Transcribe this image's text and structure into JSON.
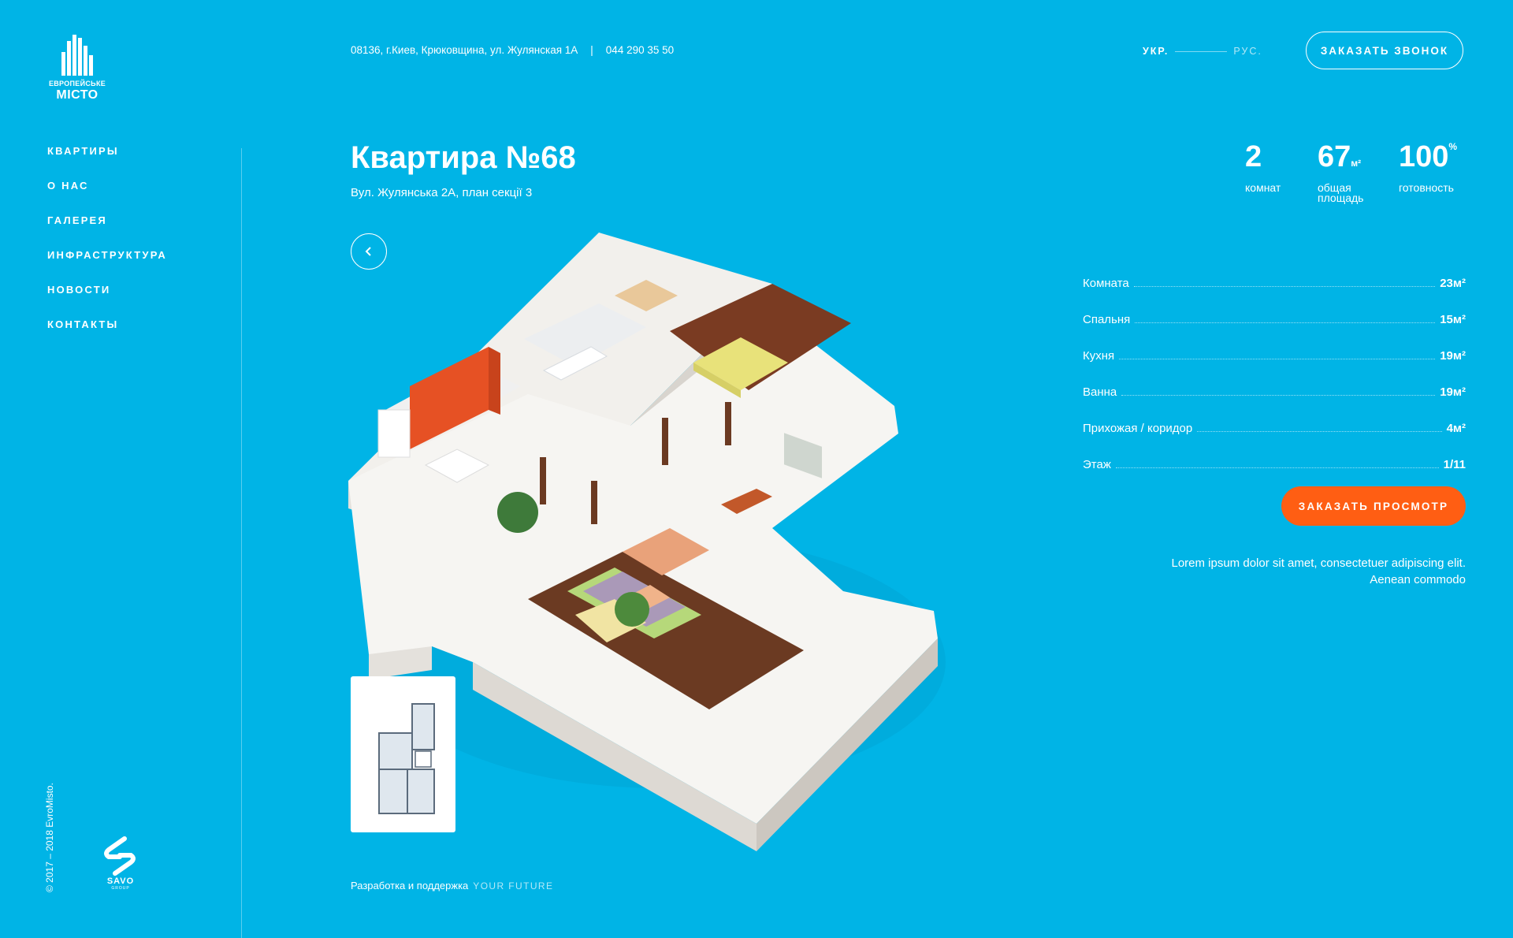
{
  "brand": {
    "line1": "ЕВРОПЕЙСЬКЕ",
    "line2": "МІСТО"
  },
  "nav": [
    "КВАРТИРЫ",
    "О НАС",
    "ГАЛЕРЕЯ",
    "ИНФРАСТРУКТУРА",
    "НОВОСТИ",
    "КОНТАКТЫ"
  ],
  "header": {
    "address": "08136, г.Киев, Крюковщина, ул. Жулянская 1А",
    "separator": "|",
    "phone": "044 290 35 50",
    "lang_ua": "УКР.",
    "lang_ru": "РУС.",
    "callback_label": "ЗАКАЗАТЬ ЗВОНОК"
  },
  "apartment": {
    "title": "Квартира №68",
    "subtitle": "Вул. Жулянська 2А,  план секції 3"
  },
  "stats": {
    "rooms_num": "2",
    "rooms_label": "комнат",
    "area_num": "67",
    "area_unit": "м²",
    "area_label_1": "общая",
    "area_label_2": "площадь",
    "ready_num": "100",
    "ready_unit": "%",
    "ready_label": "готовность"
  },
  "rooms": [
    {
      "name": "Комната",
      "value": "23м²"
    },
    {
      "name": "Спальня",
      "value": "15м²"
    },
    {
      "name": "Кухня",
      "value": "19м²"
    },
    {
      "name": "Ванна",
      "value": "19м²"
    },
    {
      "name": "Прихожая / коридор",
      "value": "4м²"
    },
    {
      "name": "Этаж",
      "value": "1/11"
    }
  ],
  "view_button": "ЗАКАЗАТЬ ПРОСМОТР",
  "description_1": "Lorem ipsum dolor sit amet, consectetuer adipiscing elit.",
  "description_2": "Aenean commodo",
  "footer": {
    "dev_label": "Разработка и поддержка",
    "dev_brand": "YOUR FUTURE",
    "copyright": "© 2017 – 2018 EvroMisto.",
    "partner_name": "SAVO",
    "partner_sub": "GROUP"
  },
  "colors": {
    "background": "#00b4e6",
    "accent": "#ff5e13",
    "text": "#ffffff"
  },
  "icons": {
    "back": "chevron-left-icon",
    "logo": "city-towers-logo",
    "partner": "savo-logo"
  }
}
